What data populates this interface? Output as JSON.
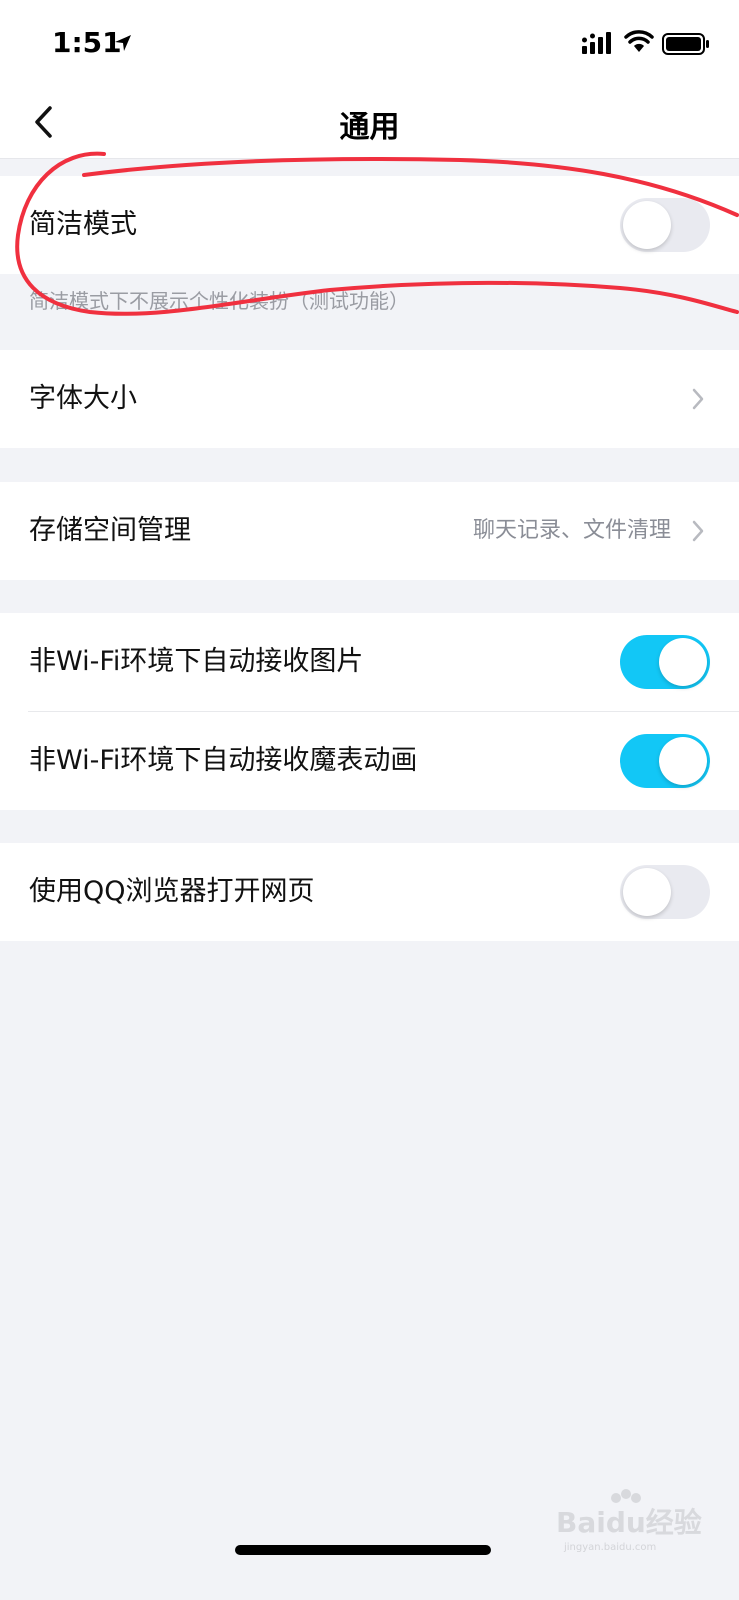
{
  "status_bar": {
    "time": "1:51"
  },
  "nav": {
    "title": "通用"
  },
  "simple_mode": {
    "label": "简洁模式",
    "enabled": false,
    "hint": "简洁模式下不展示个性化装扮（测试功能）"
  },
  "font_size": {
    "label": "字体大小"
  },
  "storage": {
    "label": "存储空间管理",
    "detail": "聊天记录、文件清理"
  },
  "media": {
    "auto_images": {
      "label": "非Wi-Fi环境下自动接收图片",
      "enabled": true
    },
    "auto_magic": {
      "label": "非Wi-Fi环境下自动接收魔表动画",
      "enabled": true
    }
  },
  "browser": {
    "label": "使用QQ浏览器打开网页",
    "enabled": false
  },
  "watermark": {
    "text": "Baidu经验",
    "sub": "jingyan.baidu.com"
  },
  "colors": {
    "toggle_on": "#12c7f6",
    "toggle_off": "#e9eaf0",
    "annotation": "#f0303f",
    "background": "#f2f3f7"
  }
}
